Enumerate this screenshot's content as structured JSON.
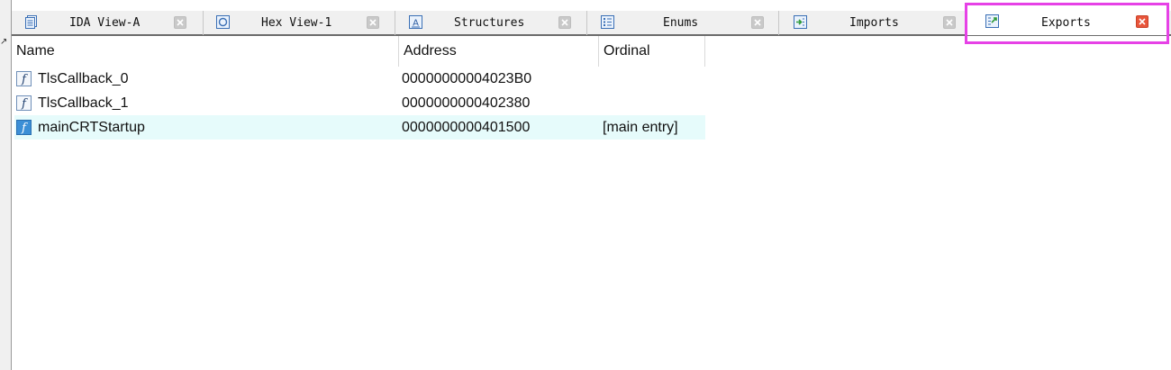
{
  "tabs": [
    {
      "label": "IDA View-A",
      "icon": "disassembly-view-icon",
      "active": false
    },
    {
      "label": "Hex View-1",
      "icon": "hex-view-icon",
      "active": false
    },
    {
      "label": "Structures",
      "icon": "structures-icon",
      "active": false
    },
    {
      "label": "Enums",
      "icon": "enums-icon",
      "active": false
    },
    {
      "label": "Imports",
      "icon": "imports-icon",
      "active": false
    },
    {
      "label": "Exports",
      "icon": "exports-icon",
      "active": true
    }
  ],
  "columns": {
    "name": "Name",
    "address": "Address",
    "ordinal": "Ordinal"
  },
  "rows": [
    {
      "name": "TlsCallback_0",
      "address": "00000000004023B0",
      "ordinal": "",
      "icon": "function-icon",
      "selected": false
    },
    {
      "name": "TlsCallback_1",
      "address": "0000000000402380",
      "ordinal": "",
      "icon": "function-icon",
      "selected": false
    },
    {
      "name": "mainCRTStartup",
      "address": "0000000000401500",
      "ordinal": "[main entry]",
      "icon": "function-icon",
      "selected": true
    }
  ],
  "colors": {
    "active_close": "#e8553b",
    "highlight": "#e641e6",
    "selected_row": "#e6fbfb"
  }
}
